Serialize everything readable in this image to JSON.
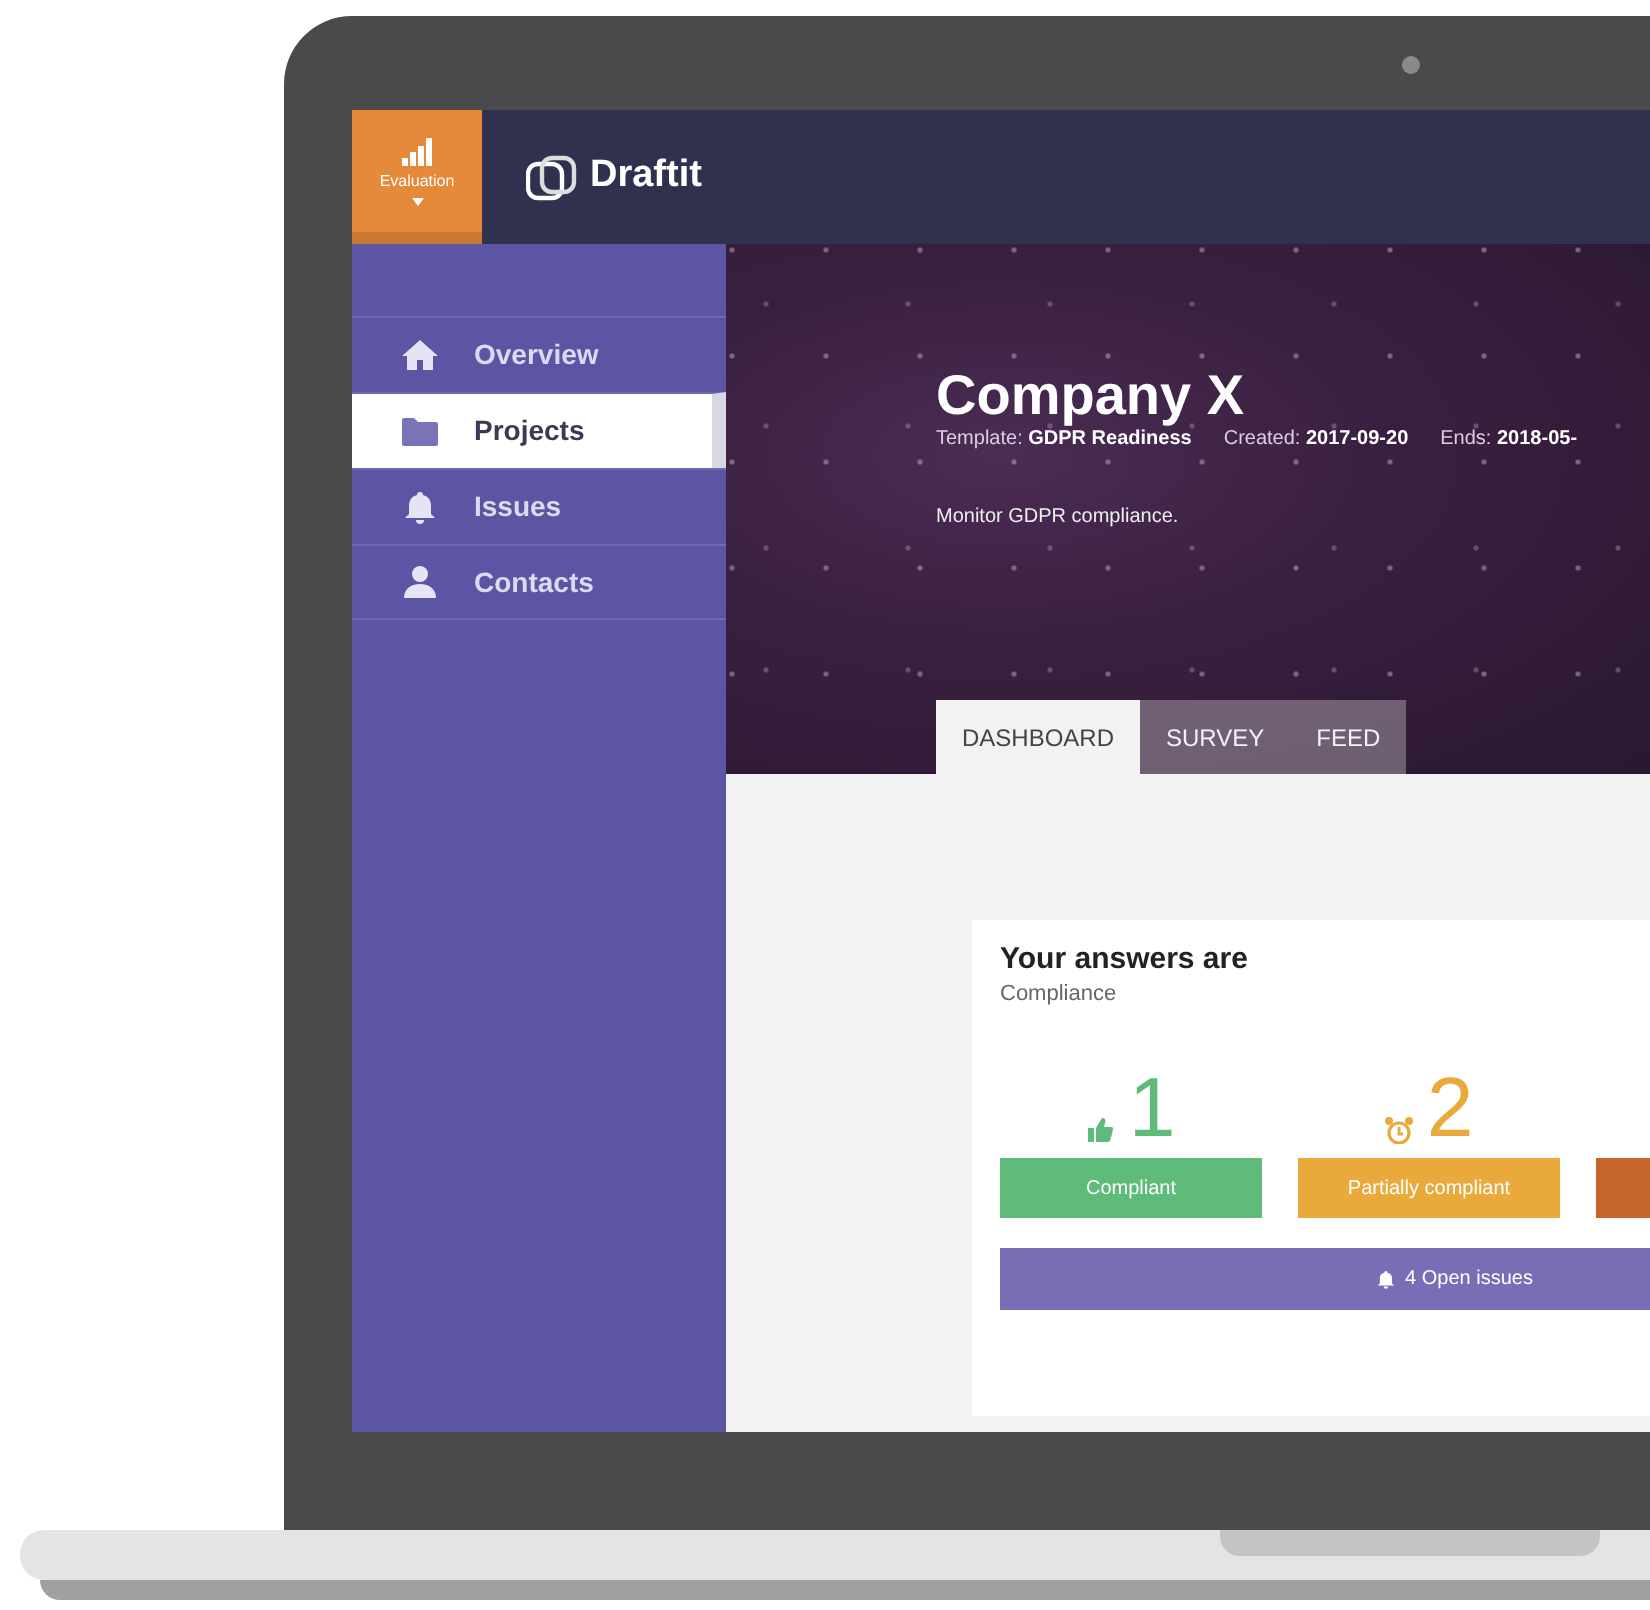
{
  "top_bar": {
    "evaluation_button": {
      "label": "Evaluation"
    },
    "logo": "Draftit"
  },
  "sidebar": {
    "items": [
      {
        "label": "Overview",
        "kind": "home",
        "selected": false
      },
      {
        "label": "Projects",
        "kind": "folder",
        "selected": true
      },
      {
        "label": "Issues",
        "kind": "bell",
        "selected": false
      },
      {
        "label": "Contacts",
        "kind": "person",
        "selected": false
      }
    ]
  },
  "project": {
    "title": "Company X",
    "meta": [
      "Template: **GDPR Readiness**",
      "Created: **2017-09-20**",
      "Ends: **2018-05-**"
    ],
    "description": "Monitor GDPR compliance."
  },
  "tabs": [
    {
      "label": "DASHBOARD",
      "selected": true
    },
    {
      "label": "SURVEY",
      "selected": false
    },
    {
      "label": "FEED",
      "selected": false
    }
  ],
  "answers_card": {
    "title": "Your answers are",
    "subtitle": "Compliance",
    "stats": [
      {
        "kind": "compliant",
        "count": "1",
        "label": "Compliant",
        "color": "#5fbb79"
      },
      {
        "kind": "partial",
        "count": "2",
        "label": "Partially compliant",
        "color": "#e9a93b"
      },
      {
        "kind": "noncompliant",
        "color": "#c6652a"
      }
    ],
    "issues_button": {
      "label": "4 Open issues"
    }
  }
}
